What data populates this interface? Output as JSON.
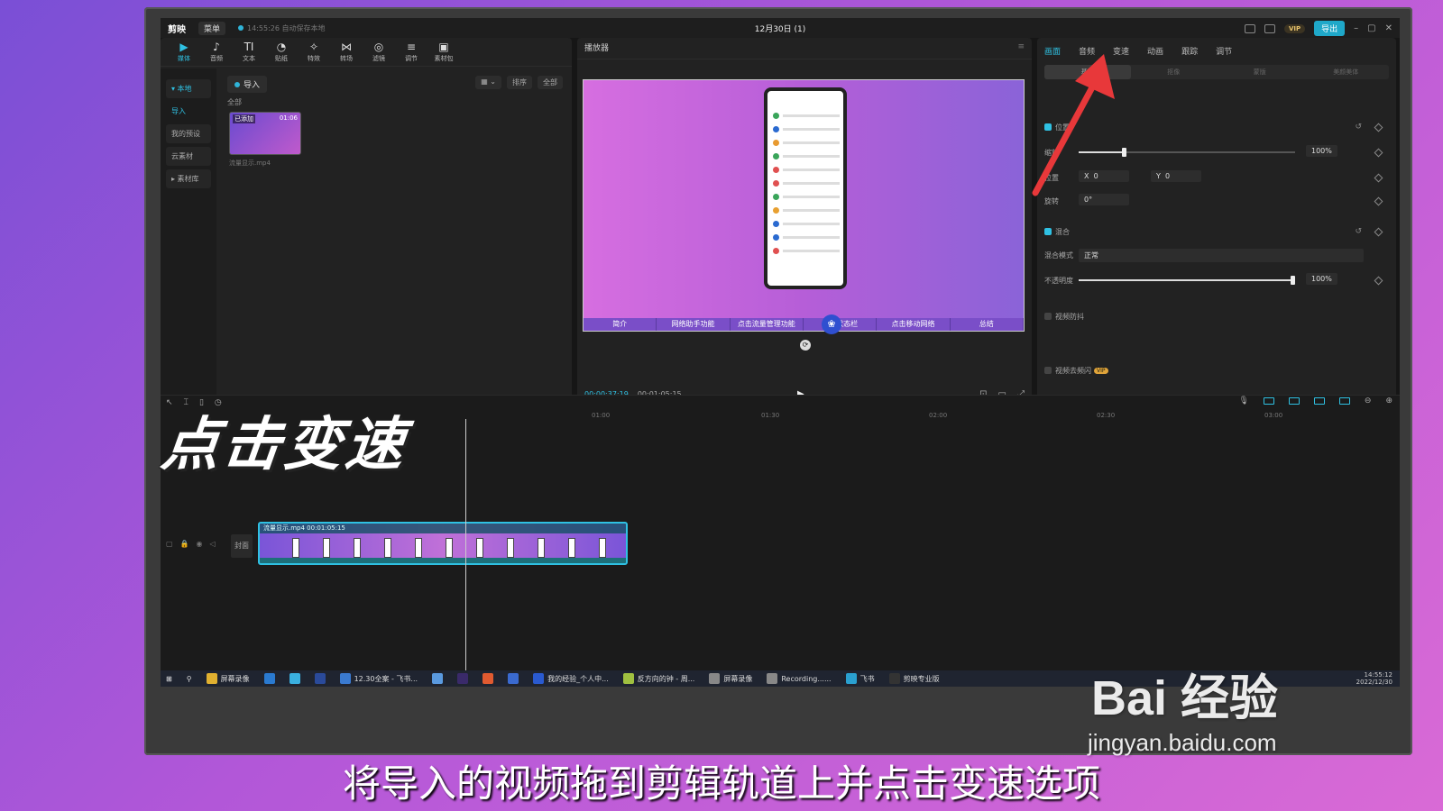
{
  "app": {
    "logo": "剪映",
    "menu_label": "菜单",
    "autosave": "14:55:26 自动保存本地",
    "project_title": "12月30日 (1)",
    "vip_label": "VIP",
    "export_label": "导出"
  },
  "toolbar": [
    {
      "icon": "▶",
      "label": "媒体"
    },
    {
      "icon": "♪",
      "label": "音频"
    },
    {
      "icon": "TI",
      "label": "文本"
    },
    {
      "icon": "◔",
      "label": "贴纸"
    },
    {
      "icon": "✧",
      "label": "特效"
    },
    {
      "icon": "⋈",
      "label": "转场"
    },
    {
      "icon": "◎",
      "label": "滤镜"
    },
    {
      "icon": "≡",
      "label": "调节"
    },
    {
      "icon": "▣",
      "label": "素材包"
    }
  ],
  "side_nav": {
    "local": "▾ 本地",
    "import": "导入",
    "presets": "我的预设",
    "cloud": "云素材",
    "library": "▸ 素材库"
  },
  "media": {
    "import_btn": "导入",
    "sort_label": "排序",
    "all_filter": "全部",
    "all_label": "全部",
    "thumb_added": "已添加",
    "thumb_duration": "01:06",
    "thumb_name": "流量显示.mp4"
  },
  "player": {
    "title": "播放器",
    "chapters": [
      "简介",
      "网络助手功能",
      "点击流量管理功能",
      "知与状态栏",
      "点击移动网络",
      "总结"
    ],
    "current_time": "00:00:37:19",
    "total_time": "00:01:05:15"
  },
  "props": {
    "tabs": [
      "画面",
      "音频",
      "变速",
      "动画",
      "跟踪",
      "调节"
    ],
    "sub_tabs": [
      "基础",
      "抠像",
      "蒙版",
      "美颜美体"
    ],
    "position_label": "位置",
    "scale_label": "缩放",
    "scale_value": "100%",
    "pos_label": "位置",
    "x_label": "X",
    "x_value": "0",
    "y_label": "Y",
    "y_value": "0",
    "rotate_label": "旋转",
    "rotate_value": "0°",
    "blend_label": "混合",
    "blend_mode_label": "混合模式",
    "blend_mode_value": "正常",
    "opacity_label": "不透明度",
    "opacity_value": "100%",
    "stabilize_label": "视频防抖",
    "denoise_label": "视频去频闪",
    "denoise_badge": "VIP"
  },
  "timeline": {
    "ruler": [
      "01:00",
      "01:30",
      "02:00",
      "02:30",
      "03:00"
    ],
    "cover_label": "封面",
    "clip_label": "流量显示.mp4    00:01:05:15"
  },
  "taskbar": [
    {
      "label": "屏幕录像",
      "color": "#e0b030"
    },
    {
      "label": "",
      "color": "#2a7ad0"
    },
    {
      "label": "",
      "color": "#3ab0e0"
    },
    {
      "label": "",
      "color": "#2a4a9a"
    },
    {
      "label": "12.30全案 - 飞书...",
      "color": "#3a7ad0"
    },
    {
      "label": "",
      "color": "#5a9ae0"
    },
    {
      "label": "",
      "color": "#3a2a6a"
    },
    {
      "label": "",
      "color": "#e05a30"
    },
    {
      "label": "",
      "color": "#3a6ad0"
    },
    {
      "label": "我的经验_个人中...",
      "color": "#2a5ad0"
    },
    {
      "label": "反方向的钟 - 周...",
      "color": "#a0c040"
    },
    {
      "label": "屏幕录像",
      "color": "#888"
    },
    {
      "label": "Recording......",
      "color": "#888"
    },
    {
      "label": "飞书",
      "color": "#2aa0d0"
    },
    {
      "label": "剪映专业版",
      "color": "#333"
    }
  ],
  "taskbar_clock": {
    "time": "14:55:12",
    "date": "2022/12/30"
  },
  "overlay": {
    "title": "点击变速",
    "subtitle": "将导入的视频拖到剪辑轨道上并点击变速选项"
  },
  "watermark": {
    "brand": "Bai 经验",
    "url": "jingyan.baidu.com"
  },
  "colors": {
    "accent": "#2fc1e3",
    "arrow": "#e8383a"
  }
}
